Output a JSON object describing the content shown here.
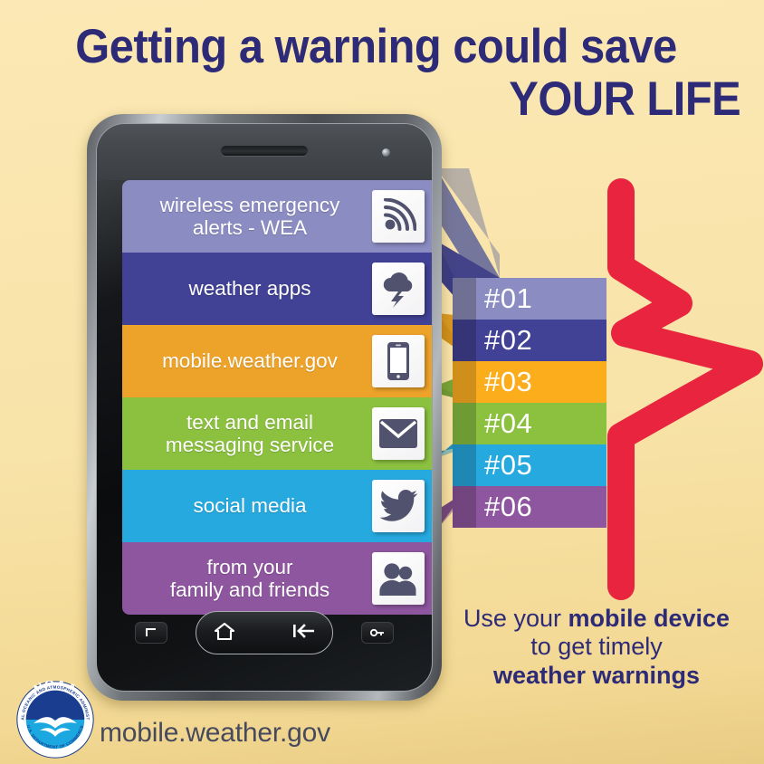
{
  "poster": {
    "background_color": "#f8e3a8",
    "headline_color": "#2d2a78",
    "accent_red": "#e8243f"
  },
  "headline": {
    "line1": "Getting a warning could save",
    "line2": "YOUR LIFE"
  },
  "phone": {
    "rows": [
      {
        "label_line1": "wireless emergency",
        "label_line2": "alerts - WEA",
        "color": "#8b8cc2",
        "icon": "wireless-signal-icon",
        "number": "#01"
      },
      {
        "label_line1": "weather apps",
        "label_line2": "",
        "color": "#414195",
        "icon": "storm-cloud-icon",
        "number": "#02"
      },
      {
        "label_line1": "mobile.weather.gov",
        "label_line2": "",
        "color": "#eda32a",
        "icon": "mobile-phone-icon",
        "number": "#03"
      },
      {
        "label_line1": "text and email",
        "label_line2": "messaging service",
        "color": "#8cc140",
        "icon": "envelope-icon",
        "number": "#04"
      },
      {
        "label_line1": "social media",
        "label_line2": "",
        "color": "#26a9df",
        "icon": "twitter-bird-icon",
        "number": "#05"
      },
      {
        "label_line1": "from your",
        "label_line2": "family and friends",
        "color": "#8e569f",
        "icon": "people-icon",
        "number": "#06"
      }
    ],
    "controls": {
      "left_button": "menu-button",
      "home_button": "home-button",
      "back_button": "back-button",
      "right_button": "lock-key-button"
    }
  },
  "numbers": {
    "bars": [
      {
        "label": "#01",
        "color": "#8b8cc2",
        "tab_color": "#6f7094"
      },
      {
        "label": "#02",
        "color": "#414195",
        "tab_color": "#343476"
      },
      {
        "label": "#03",
        "color": "#fbad1c",
        "tab_color": "#d08f1a"
      },
      {
        "label": "#04",
        "color": "#8cc140",
        "tab_color": "#6f9b34"
      },
      {
        "label": "#05",
        "color": "#26a9df",
        "tab_color": "#1e87b3"
      },
      {
        "label": "#06",
        "color": "#8e569f",
        "tab_color": "#72457f"
      }
    ]
  },
  "tagline": {
    "line1_plain": "Use your ",
    "line1_bold": "mobile device",
    "line2": "to get timely",
    "line3_bold": "weather warnings"
  },
  "footer": {
    "url": "mobile.weather.gov",
    "logo": {
      "name": "noaa-seal",
      "ring_text_top": "NATIONAL OCEANIC AND ATMOSPHERIC ADMINISTRATION",
      "ring_text_bottom": "U.S. DEPARTMENT OF COMMERCE",
      "acronym": "NOAA",
      "navy": "#1b3d8f",
      "cyan": "#1ba8e0"
    }
  }
}
